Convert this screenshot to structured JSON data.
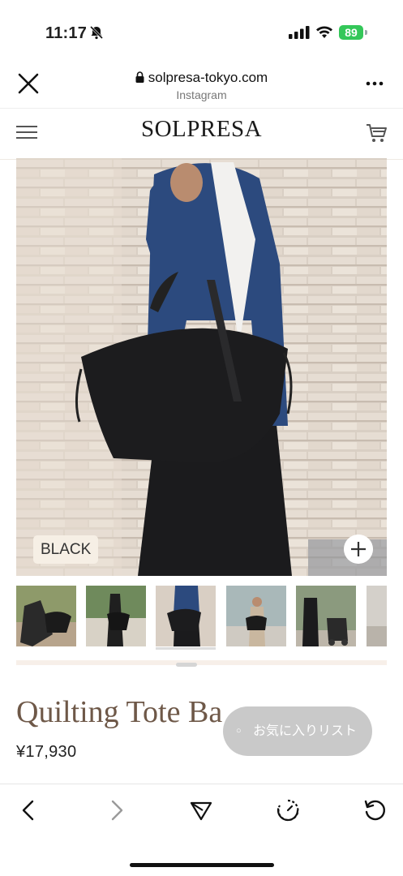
{
  "status_bar": {
    "time": "11:17",
    "battery": "89"
  },
  "browser": {
    "url": "solpresa-tokyo.com",
    "source": "Instagram"
  },
  "site": {
    "logo": "SOLPRESA"
  },
  "product": {
    "color_label": "BLACK",
    "title": "Quilting Tote Ba",
    "price": "¥17,930",
    "favorite_button": "お気に入りリスト"
  },
  "thumbnails": [
    {
      "name": "thumb-1"
    },
    {
      "name": "thumb-2"
    },
    {
      "name": "thumb-3",
      "active": true
    },
    {
      "name": "thumb-4"
    },
    {
      "name": "thumb-5"
    },
    {
      "name": "thumb-6"
    }
  ],
  "colors": {
    "title_brown": "#6e5848",
    "badge_bg": "#f6efe5",
    "battery_green": "#34c759"
  }
}
